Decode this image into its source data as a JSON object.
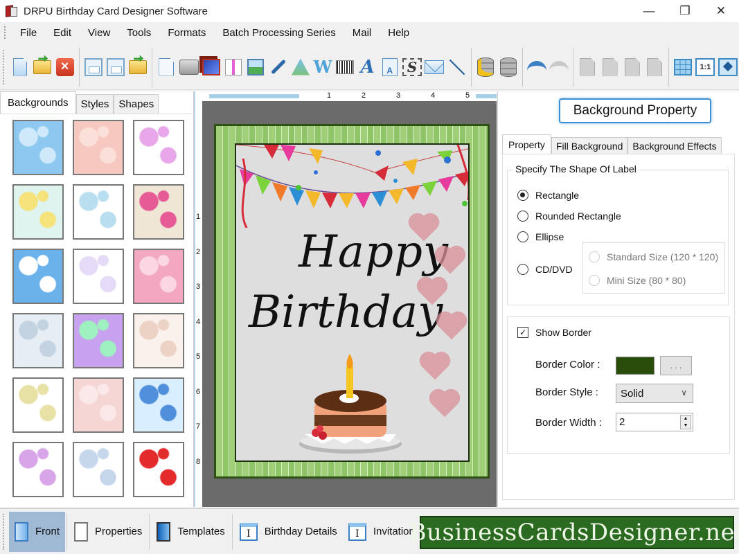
{
  "window": {
    "title": "DRPU Birthday Card Designer Software",
    "controls": {
      "minimize": "—",
      "restore": "❐",
      "close": "✕"
    }
  },
  "menu": [
    "File",
    "Edit",
    "View",
    "Tools",
    "Formats",
    "Batch Processing Series",
    "Mail",
    "Help"
  ],
  "toolbar": {
    "groups": [
      [
        "new-icon",
        "open-icon",
        "close-icon"
      ],
      [
        "save-icon",
        "save-as-icon",
        "export-icon"
      ],
      [
        "properties-icon",
        "print-icon",
        "print-multiple-icon",
        "gift-icon",
        "insert-image-icon",
        "pen-icon",
        "shapes-icon",
        "wordart-icon",
        "barcode-icon",
        "text-icon",
        "text-doc-icon",
        "signature-icon",
        "email-icon",
        "line-icon"
      ],
      [
        "database-new-icon",
        "database-icon"
      ],
      [
        "undo-icon",
        "redo-icon"
      ],
      [
        "cut-icon",
        "copy-icon",
        "paste-icon",
        "delete-icon"
      ],
      [
        "grid-icon",
        "actual-size-icon",
        "fit-window-icon"
      ]
    ],
    "labels": {
      "textdoc": "A",
      "signature": "S",
      "actual_size": "1:1",
      "wordart": "W",
      "text": "A"
    }
  },
  "left_panel": {
    "tabs": [
      {
        "label": "Backgrounds",
        "active": true
      },
      {
        "label": "Styles",
        "active": false
      },
      {
        "label": "Shapes",
        "active": false
      }
    ],
    "thumbnails": [
      {
        "name": "clouds",
        "colors": [
          "#8cc8ef",
          "#cfe9fb"
        ]
      },
      {
        "name": "pink-pattern",
        "colors": [
          "#f6c8c0",
          "#fbe0da"
        ]
      },
      {
        "name": "butterflies",
        "colors": [
          "#ffffff",
          "#e7a7e8"
        ]
      },
      {
        "name": "flowers",
        "colors": [
          "#dff3ef",
          "#f5e27b"
        ]
      },
      {
        "name": "bears-drawing",
        "colors": [
          "#ffffff",
          "#b9def0"
        ]
      },
      {
        "name": "bird-balloons",
        "colors": [
          "#efe6d6",
          "#e65a96"
        ]
      },
      {
        "name": "stars",
        "colors": [
          "#6cb2ea",
          "#ffffff"
        ]
      },
      {
        "name": "balloons-pastel",
        "colors": [
          "#ffffff",
          "#e6dbf6"
        ]
      },
      {
        "name": "pink-cakes",
        "colors": [
          "#f3a7c0",
          "#fbd7e3"
        ]
      },
      {
        "name": "bubbles",
        "colors": [
          "#e6edf4",
          "#c3d3e1"
        ]
      },
      {
        "name": "rainbow",
        "colors": [
          "#c7a3ef",
          "#9ff0c0"
        ]
      },
      {
        "name": "teddy",
        "colors": [
          "#faf1ec",
          "#ecd2c4"
        ]
      },
      {
        "name": "happy-birthday-text",
        "colors": [
          "#ffffff",
          "#e8e1a5"
        ]
      },
      {
        "name": "pink-hearts-stripes",
        "colors": [
          "#f6d5d5",
          "#fbe9e9"
        ]
      },
      {
        "name": "balloons-blue",
        "colors": [
          "#d9efff",
          "#4f8fdc"
        ]
      },
      {
        "name": "colorful-hearts",
        "colors": [
          "#ffffff",
          "#d8a6e8"
        ]
      },
      {
        "name": "balloon-bunches",
        "colors": [
          "#ffffff",
          "#c6d7ec"
        ]
      },
      {
        "name": "red-hearts",
        "colors": [
          "#ffffff",
          "#e32b2b"
        ]
      }
    ]
  },
  "rulers": {
    "horizontal": [
      "1",
      "2",
      "3",
      "4",
      "5"
    ],
    "vertical": [
      "1",
      "2",
      "3",
      "4",
      "5",
      "6",
      "7",
      "8"
    ]
  },
  "card": {
    "line1": "Happy",
    "line2": "Birthday",
    "border_color": "#2e5215",
    "frame_color": "#a0ce79"
  },
  "right_panel": {
    "title_button": "Background Property",
    "tabs": [
      {
        "label": "Property",
        "active": true
      },
      {
        "label": "Fill Background",
        "active": false
      },
      {
        "label": "Background Effects",
        "active": false
      }
    ],
    "shape_group": {
      "title": "Specify The Shape Of Label",
      "options": [
        {
          "label": "Rectangle",
          "checked": true
        },
        {
          "label": "Rounded Rectangle",
          "checked": false
        },
        {
          "label": "Ellipse",
          "checked": false
        },
        {
          "label": "CD/DVD",
          "checked": false
        }
      ],
      "cd_sizes": [
        {
          "label": "Standard Size (120 * 120)",
          "enabled": false
        },
        {
          "label": "Mini Size (80 * 80)",
          "enabled": false
        }
      ]
    },
    "border_group": {
      "show_border_label": "Show Border",
      "show_border_checked": true,
      "color_label": "Border Color :",
      "color_value": "#2b4d0c",
      "color_button": ". . .",
      "style_label": "Border Style :",
      "style_value": "Solid",
      "width_label": "Border Width :",
      "width_value": "2"
    }
  },
  "bottom_bar": {
    "buttons": [
      {
        "label": "Front",
        "active": true,
        "icon": "front-page-icon"
      },
      {
        "label": "Properties",
        "active": false,
        "icon": "properties-icon"
      },
      {
        "label": "Templates",
        "active": false,
        "icon": "templates-icon"
      },
      {
        "label": "Birthday Details",
        "active": false,
        "icon": "birthday-details-icon"
      },
      {
        "label": "Invitation",
        "active": false,
        "icon": "invitation-icon"
      }
    ],
    "brand": "BusinessCardsDesigner.net",
    "brand_color": "#2b6a21"
  }
}
